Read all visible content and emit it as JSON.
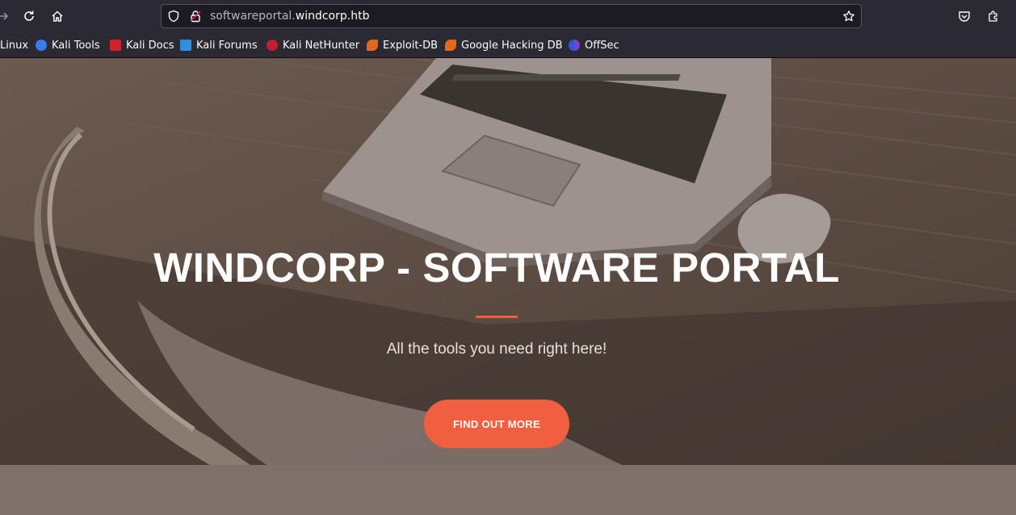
{
  "browser": {
    "url_prefix": "softwareportal.",
    "url_domain": "windcorp.htb",
    "icons": {
      "forward": "arrow-right-icon",
      "reload": "reload-icon",
      "home": "home-icon",
      "shield": "shield-icon",
      "lock": "lock-icon",
      "bookmark_star": "star-icon",
      "pocket": "pocket-icon",
      "extensions": "puzzle-icon"
    },
    "bookmarks": [
      {
        "label": "Linux",
        "icon": "kali-icon"
      },
      {
        "label": "Kali Tools",
        "icon": "kali-tools-icon"
      },
      {
        "label": "Kali Docs",
        "icon": "kali-docs-icon"
      },
      {
        "label": "Kali Forums",
        "icon": "kali-forums-icon"
      },
      {
        "label": "Kali NetHunter",
        "icon": "nethunter-icon"
      },
      {
        "label": "Exploit-DB",
        "icon": "exploitdb-icon"
      },
      {
        "label": "Google Hacking DB",
        "icon": "ghdb-icon"
      },
      {
        "label": "OffSec",
        "icon": "offsec-icon"
      }
    ]
  },
  "hero": {
    "title": "WINDCORP - SOFTWARE PORTAL",
    "subtitle": "All the tools you need right here!",
    "cta_label": "FIND OUT MORE",
    "accent_color": "#f05f40"
  }
}
